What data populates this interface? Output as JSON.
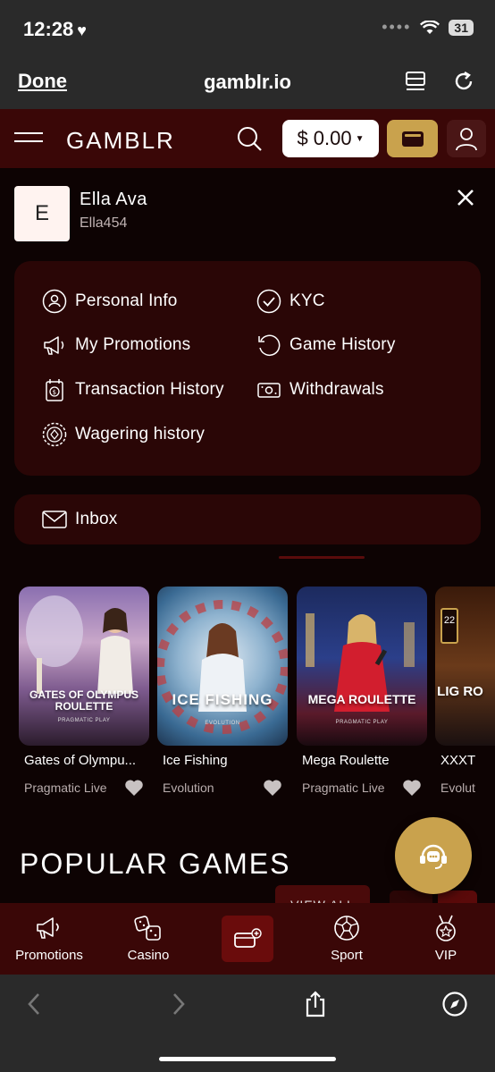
{
  "status_bar": {
    "time": "12:28",
    "battery": "31"
  },
  "browser": {
    "done_label": "Done",
    "domain": "gamblr.io"
  },
  "header": {
    "brand": "GAMBLR",
    "balance": "$ 0.00"
  },
  "user": {
    "initial": "E",
    "name": "Ella Ava",
    "handle": "Ella454"
  },
  "menu": {
    "personal_info": "Personal Info",
    "kyc": "KYC",
    "my_promotions": "My Promotions",
    "game_history": "Game History",
    "transaction_history": "Transaction History",
    "withdrawals": "Withdrawals",
    "wagering_history": "Wagering history",
    "inbox": "Inbox"
  },
  "games": [
    {
      "thumb_title": "GATES OF OLYMPUS ROULETTE",
      "thumb_provider": "PRAGMATIC PLAY",
      "name": "Gates of Olympu...",
      "provider": "Pragmatic Live"
    },
    {
      "thumb_title": "ICE FISHING",
      "thumb_provider": "EVOLUTION",
      "name": "Ice Fishing",
      "provider": "Evolution"
    },
    {
      "thumb_title": "MEGA ROULETTE",
      "thumb_provider": "PRAGMATIC PLAY",
      "name": "Mega Roulette",
      "provider": "Pragmatic Live"
    },
    {
      "thumb_title": "LIG RO",
      "thumb_badge": "22",
      "thumb_provider": "",
      "name": "XXXT",
      "provider": "Evolut"
    }
  ],
  "popular": {
    "title": "POPULAR GAMES",
    "view_all": "VIEW ALL"
  },
  "bottom_nav": {
    "promotions": "Promotions",
    "casino": "Casino",
    "sport": "Sport",
    "vip": "VIP"
  },
  "colors": {
    "accent_gold": "#c9a24d",
    "header_bg": "#3a0707",
    "panel_bg": "#2a0606"
  }
}
